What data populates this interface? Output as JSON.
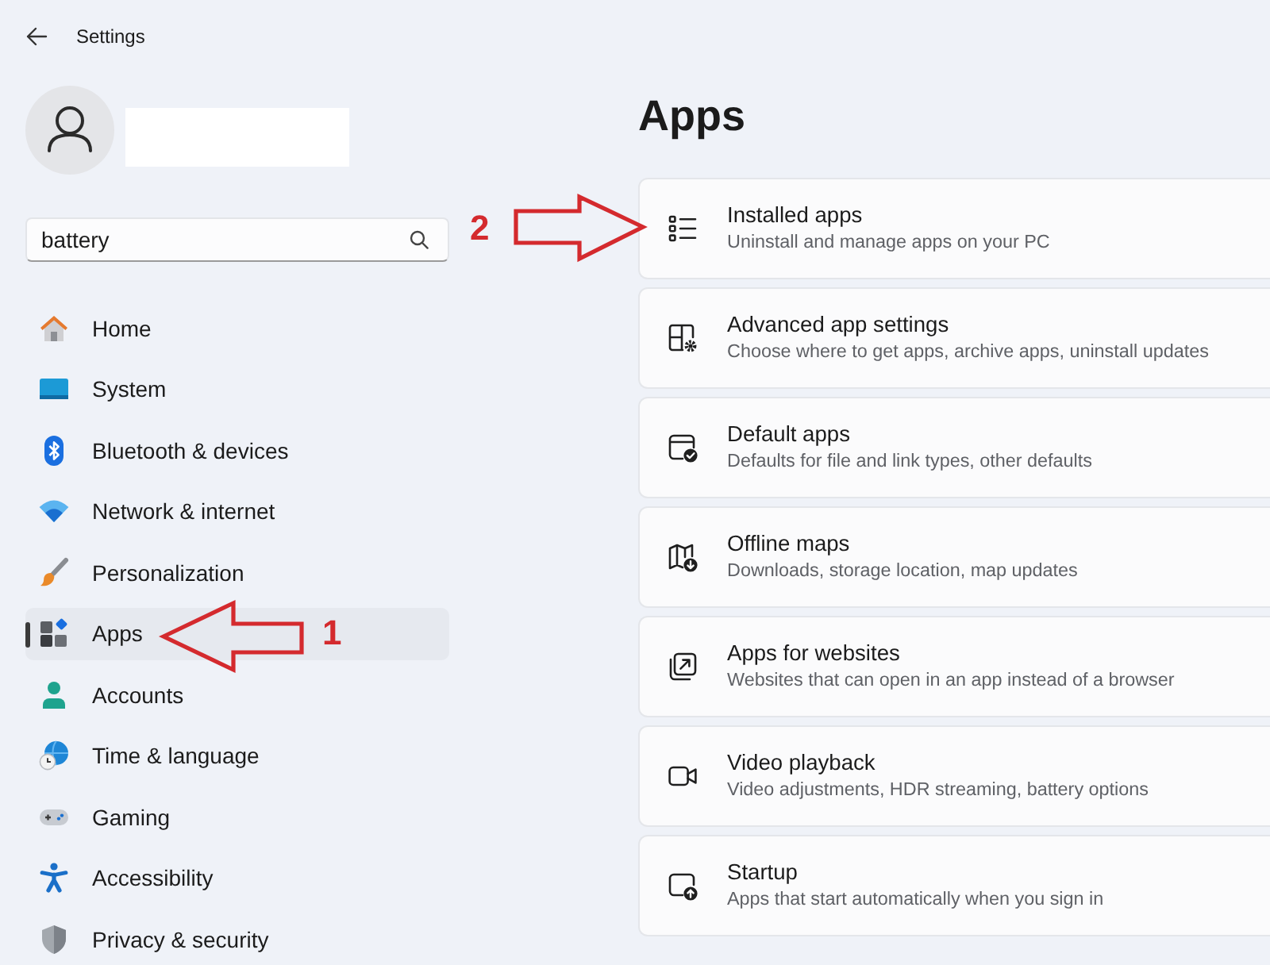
{
  "window": {
    "title": "Settings"
  },
  "search": {
    "value": "battery"
  },
  "sidebar": {
    "items": [
      {
        "label": "Home",
        "selected": false
      },
      {
        "label": "System",
        "selected": false
      },
      {
        "label": "Bluetooth & devices",
        "selected": false
      },
      {
        "label": "Network & internet",
        "selected": false
      },
      {
        "label": "Personalization",
        "selected": false
      },
      {
        "label": "Apps",
        "selected": true
      },
      {
        "label": "Accounts",
        "selected": false
      },
      {
        "label": "Time & language",
        "selected": false
      },
      {
        "label": "Gaming",
        "selected": false
      },
      {
        "label": "Accessibility",
        "selected": false
      },
      {
        "label": "Privacy & security",
        "selected": false
      }
    ]
  },
  "page": {
    "title": "Apps",
    "cards": [
      {
        "title": "Installed apps",
        "subtitle": "Uninstall and manage apps on your PC"
      },
      {
        "title": "Advanced app settings",
        "subtitle": "Choose where to get apps, archive apps, uninstall updates"
      },
      {
        "title": "Default apps",
        "subtitle": "Defaults for file and link types, other defaults"
      },
      {
        "title": "Offline maps",
        "subtitle": "Downloads, storage location, map updates"
      },
      {
        "title": "Apps for websites",
        "subtitle": "Websites that can open in an app instead of a browser"
      },
      {
        "title": "Video playback",
        "subtitle": "Video adjustments, HDR streaming, battery options"
      },
      {
        "title": "Startup",
        "subtitle": "Apps that start automatically when you sign in"
      }
    ]
  },
  "annotations": [
    {
      "kind": "left-arrow",
      "label": "1"
    },
    {
      "kind": "right-arrow",
      "label": "2"
    }
  ]
}
